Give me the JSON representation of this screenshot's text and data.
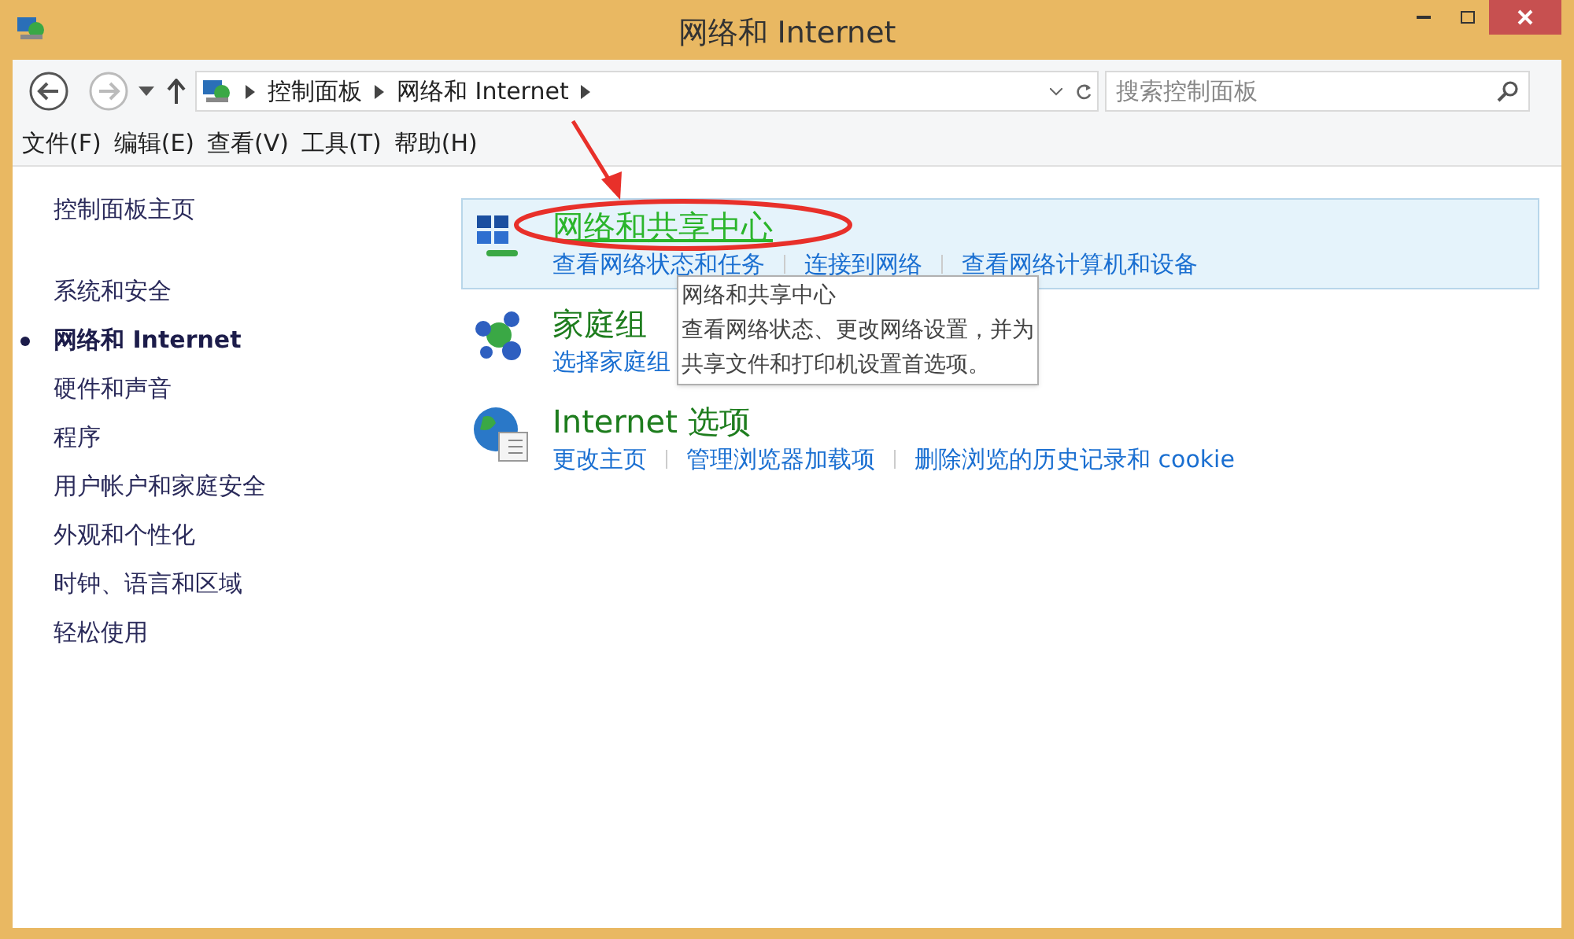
{
  "window": {
    "title": "网络和 Internet"
  },
  "nav": {
    "breadcrumbs": [
      "控制面板",
      "网络和 Internet"
    ],
    "search": {
      "placeholder": "搜索控制面板"
    }
  },
  "menu": [
    "文件(F)",
    "编辑(E)",
    "查看(V)",
    "工具(T)",
    "帮助(H)"
  ],
  "sidebar": {
    "home": "控制面板主页",
    "items": [
      {
        "label": "系统和安全",
        "selected": false
      },
      {
        "label": "网络和 Internet",
        "selected": true
      },
      {
        "label": "硬件和声音",
        "selected": false
      },
      {
        "label": "程序",
        "selected": false
      },
      {
        "label": "用户帐户和家庭安全",
        "selected": false
      },
      {
        "label": "外观和个性化",
        "selected": false
      },
      {
        "label": "时钟、语言和区域",
        "selected": false
      },
      {
        "label": "轻松使用",
        "selected": false
      }
    ]
  },
  "sections": [
    {
      "kind": "network",
      "title": "网络和共享中心",
      "hovered": true,
      "links": [
        "查看网络状态和任务",
        "连接到网络",
        "查看网络计算机和设备"
      ]
    },
    {
      "kind": "homegroup",
      "title": "家庭组",
      "hovered": false,
      "links": [
        "选择家庭组"
      ]
    },
    {
      "kind": "internet",
      "title": "Internet 选项",
      "hovered": false,
      "links": [
        "更改主页",
        "管理浏览器加载项",
        "删除浏览的历史记录和 cookie"
      ]
    }
  ],
  "tooltip": {
    "title": "网络和共享中心",
    "lines": [
      "查看网络状态、更改网络设置，并为",
      "共享文件和打印机设置首选项。"
    ]
  }
}
